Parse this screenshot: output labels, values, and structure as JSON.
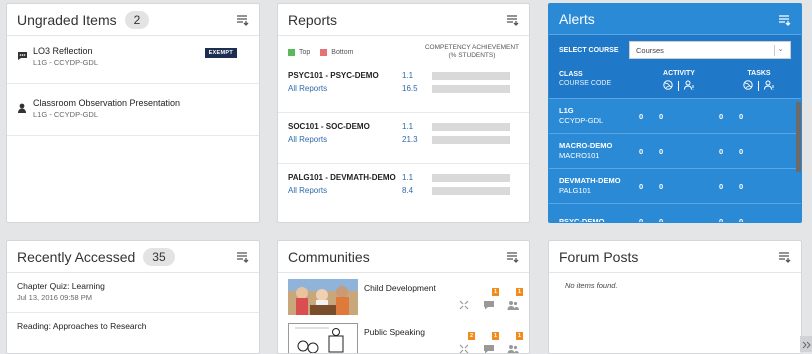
{
  "ungraded": {
    "title": "Ungraded Items",
    "count": "2",
    "items": [
      {
        "title": "LO3 Reflection",
        "course": "L1G - CCYDP-GDL",
        "badge": "EXEMPT",
        "icon": "comment-icon"
      },
      {
        "title": "Classroom Observation Presentation",
        "course": "L1G - CCYDP-GDL",
        "badge": "",
        "icon": "user-icon"
      }
    ]
  },
  "reports": {
    "title": "Reports",
    "legend_top": "Top",
    "legend_bottom": "Bottom",
    "legend_top_color": "#5cb85c",
    "legend_bottom_color": "#e57373",
    "comp_line1": "COMPETENCY ACHIEVEMENT",
    "comp_line2": "(% STUDENTS)",
    "rows": [
      {
        "course": "PSYC101 - PSYC-DEMO",
        "link": "All Reports",
        "top": "1.1",
        "bottom": "16.5"
      },
      {
        "course": "SOC101 - SOC-DEMO",
        "link": "All Reports",
        "top": "1.1",
        "bottom": "21.3"
      },
      {
        "course": "PALG101 - DEVMATH-DEMO",
        "link": "All Reports",
        "top": "1.1",
        "bottom": "8.4"
      }
    ]
  },
  "alerts": {
    "title": "Alerts",
    "select_label": "SELECT COURSE",
    "select_value": "Courses",
    "col_class": "CLASS",
    "col_course_code": "COURSE CODE",
    "col_activity": "ACTIVITY",
    "col_tasks": "TASKS",
    "rows": [
      {
        "cls": "L1G",
        "code": "CCYDP-GDL",
        "a1": "0",
        "a2": "0",
        "t1": "0",
        "t2": "0"
      },
      {
        "cls": "MACRO-DEMO",
        "code": "MACRO101",
        "a1": "0",
        "a2": "0",
        "t1": "0",
        "t2": "0"
      },
      {
        "cls": "DEVMATH-DEMO",
        "code": "PALG101",
        "a1": "0",
        "a2": "0",
        "t1": "0",
        "t2": "0"
      },
      {
        "cls": "PSYC-DEMO",
        "code": "",
        "a1": "0",
        "a2": "0",
        "t1": "0",
        "t2": "0"
      }
    ]
  },
  "recent": {
    "title": "Recently Accessed",
    "count": "35",
    "items": [
      {
        "title": "Chapter Quiz: Learning",
        "date": "Jul 13, 2016 09:58 PM"
      },
      {
        "title": "Reading: Approaches to Research",
        "date": ""
      }
    ]
  },
  "communities": {
    "title": "Communities",
    "items": [
      {
        "name": "Child Development",
        "n1": "1",
        "n2": "1"
      },
      {
        "name": "Public Speaking",
        "n0": "2",
        "n1": "1",
        "n2": "1"
      }
    ]
  },
  "forum": {
    "title": "Forum Posts",
    "empty": "No items found."
  }
}
